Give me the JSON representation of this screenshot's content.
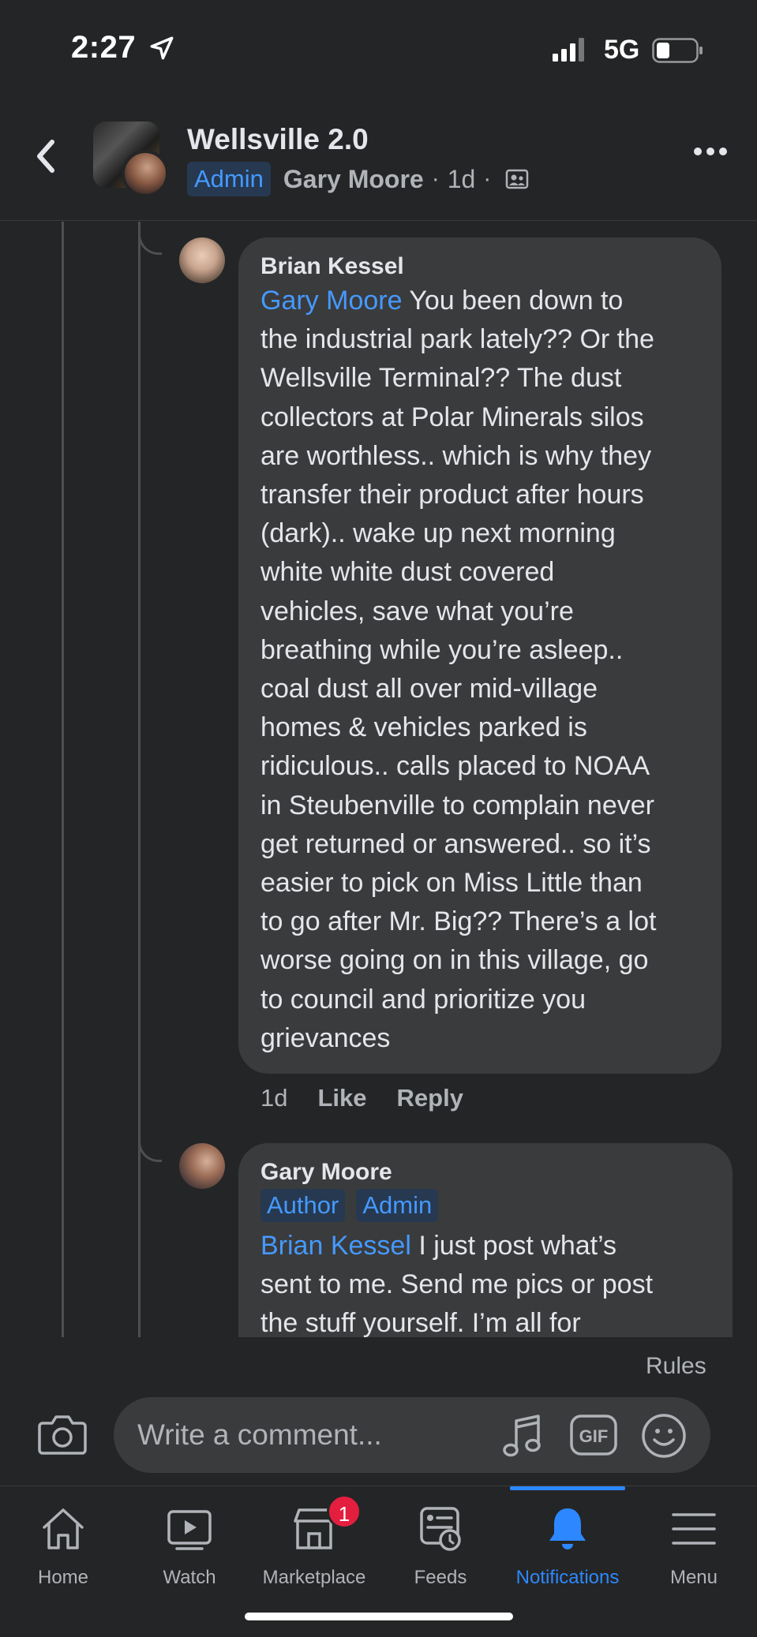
{
  "status_bar": {
    "time": "2:27",
    "network": "5G"
  },
  "header": {
    "group_name": "Wellsville 2.0",
    "badge": "Admin",
    "author": "Gary Moore",
    "separator": "·",
    "time": "1d"
  },
  "comments": [
    {
      "author": "Brian Kessel",
      "mention": "Gary Moore",
      "lines": [
        " You been down to",
        "the industrial park lately?? Or the",
        "Wellsville Terminal?? The  dust",
        "collectors at Polar Minerals silos",
        "are worthless.. which is why they",
        "transfer their product after hours",
        "(dark).. wake up next morning",
        "white white dust covered",
        "vehicles, save what you’re",
        "breathing while you’re asleep..",
        "coal dust all over mid-village",
        "homes & vehicles parked is",
        "ridiculous.. calls placed to NOAA",
        "in Steubenville to complain never",
        "get returned or answered.. so it’s",
        "easier to pick on Miss Little than",
        "to go after Mr. Big?? There’s a lot",
        "worse going on in this village, go",
        "to council and prioritize you",
        "grievances"
      ],
      "time": "1d",
      "like": "Like",
      "reply": "Reply"
    },
    {
      "author": "Gary Moore",
      "badges": [
        "Author",
        "Admin"
      ],
      "mention": "Brian Kessel",
      "lines": [
        " I just post what’s",
        "sent to me. Send me pics or post",
        "the stuff yourself. I’m all for"
      ]
    }
  ],
  "composer": {
    "rules": "Rules",
    "placeholder": "Write a comment...",
    "gif_label": "GIF"
  },
  "tabs": [
    {
      "label": "Home",
      "icon": "home-icon"
    },
    {
      "label": "Watch",
      "icon": "watch-icon"
    },
    {
      "label": "Marketplace",
      "icon": "marketplace-icon",
      "badge": "1"
    },
    {
      "label": "Feeds",
      "icon": "feeds-icon"
    },
    {
      "label": "Notifications",
      "icon": "bell-icon",
      "active": true
    },
    {
      "label": "Menu",
      "icon": "menu-icon"
    }
  ],
  "colors": {
    "background": "#242526",
    "bubble": "#3a3b3c",
    "accent": "#2d88ff",
    "mention": "#4599ff",
    "badge_bg": "#263951",
    "notification_red": "#e41e3f"
  }
}
